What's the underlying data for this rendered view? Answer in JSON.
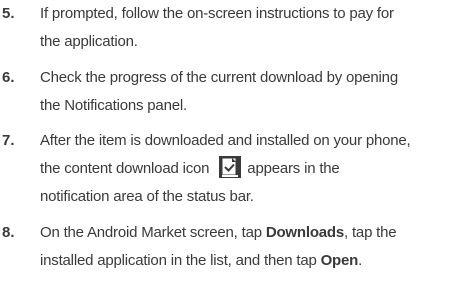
{
  "steps": [
    {
      "number": "5.",
      "line1": "If prompted, follow the on-screen instructions to pay for",
      "line2": "the application."
    },
    {
      "number": "6.",
      "line1": "Check the progress of the current download by opening",
      "line2": "the Notifications panel."
    },
    {
      "number": "7.",
      "line1": "After the item is downloaded and installed on your phone,",
      "line2_before_icon": "the content download icon",
      "line2_after_icon": "appears in the",
      "line3": "notification area of the status bar.",
      "icon": "content-download-icon"
    },
    {
      "number": "8.",
      "line1_before": "On the Android Market screen, tap ",
      "line1_bold": "Downloads",
      "line1_after": ", tap the",
      "line2_before": "installed application in the list, and then tap ",
      "line2_bold": "Open",
      "line2_after": "."
    }
  ]
}
